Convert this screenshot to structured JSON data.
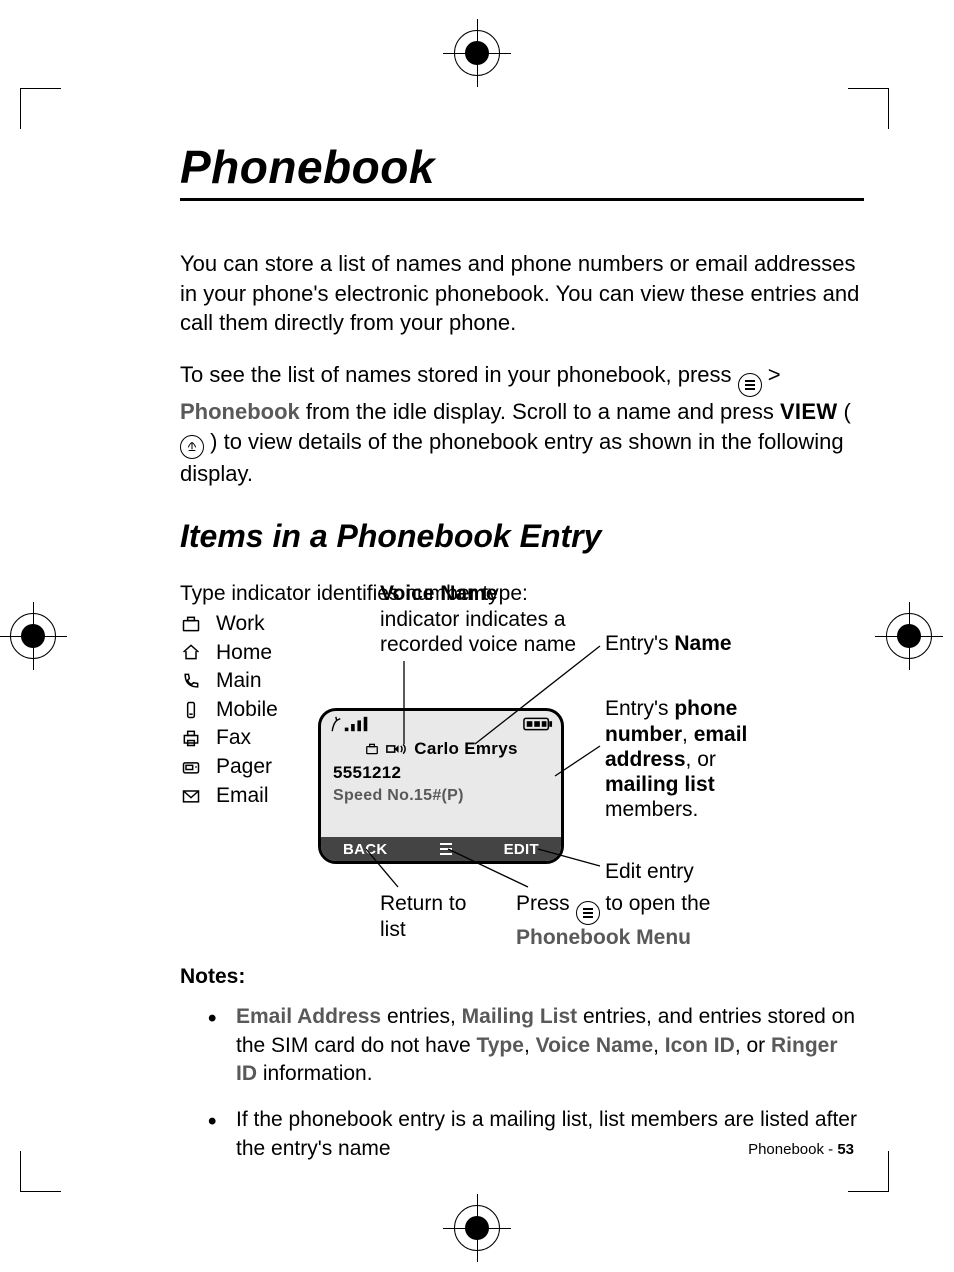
{
  "page": {
    "title": "Phonebook",
    "intro": "You can store a list of names and phone numbers or email addresses in your phone's electronic phonebook. You can view these entries and call them directly from your phone.",
    "howto_pre": "To see the list of names stored in your phonebook, press ",
    "howto_menu_sep": " > ",
    "howto_menu_item": "Phonebook",
    "howto_mid": " from the idle display. Scroll to a name and press ",
    "howto_view": "VIEW",
    "howto_post": " to view details of the phonebook entry as shown in the following display.",
    "section": "Items in a Phonebook Entry"
  },
  "type_indicator": {
    "title_bold": "Type",
    "title_rest": " indicator identifies number type:",
    "items": [
      "Work",
      "Home",
      "Main",
      "Mobile",
      "Fax",
      "Pager",
      "Email"
    ]
  },
  "voice_name": {
    "bold": "Voice Name",
    "rest": " indicator indicates a recorded voice name"
  },
  "entry_name": {
    "pre": "Entry's ",
    "bold": "Name"
  },
  "entry_value": {
    "pre": "Entry's ",
    "b1": "phone number",
    "c1": ", ",
    "b2": "email address",
    "c2": ", or ",
    "b3": "mailing list",
    "rest": " members."
  },
  "edit_entry": "Edit entry",
  "return": "Return to list",
  "press_menu": {
    "pre": "Press ",
    "post": " to open the ",
    "bold": "Phonebook Menu"
  },
  "phone": {
    "name": "Carlo Emrys",
    "number": "5551212",
    "speed": "Speed No.15#(P)",
    "back": "BACK",
    "edit": "EDIT"
  },
  "notes": {
    "heading": "Notes:",
    "n1a": "Email Address",
    "n1b": " entries, ",
    "n1c": "Mailing List",
    "n1d": " entries, and entries stored on the SIM card do not have ",
    "n1e": "Type",
    "n1f": ", ",
    "n1g": "Voice Name",
    "n1h": ", ",
    "n1i": "Icon ID",
    "n1j": ", or ",
    "n1k": "Ringer ID",
    "n1l": " information.",
    "n2": "If the phonebook entry is a mailing list, list members are listed after the entry's name"
  },
  "footer": {
    "label": "Phonebook - ",
    "page": "53"
  }
}
